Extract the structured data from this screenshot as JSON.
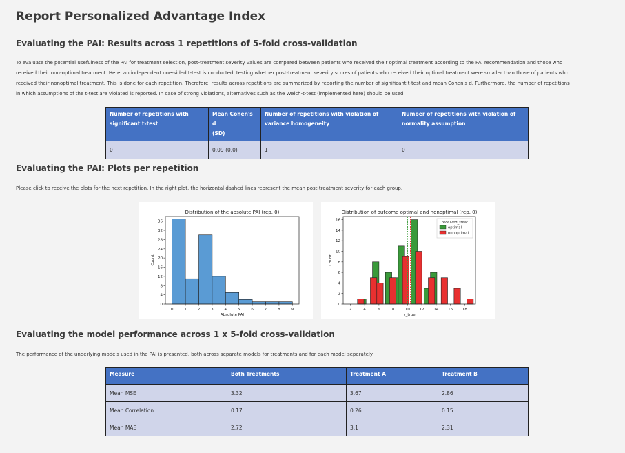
{
  "page_title": "Report Personalized Advantage Index",
  "section1": {
    "heading": "Evaluating the PAI: Results across 1 repetitions of 5-fold cross-validation",
    "paragraph_lines": [
      "To evaluate the potential usefulness of the PAI for treatment selection, post-treatment severity values are compared between patients who received their optimal treatment according to the PAI recommendation and those who",
      "received their non-optimal treatment. Here, an independent one-sided t-test is conducted, testing whether post-treatment severity scores of patients who received their optimal treatment were smaller than those of patients who",
      "received their nonoptimal treatment. This is done for each repetition. Therefore, results across repetitions are summarized by reporting the number of significant t-test and mean Cohen's d. Furthermore, the number of repetitions",
      "in which assumptions of the t-test are violated is reported. In case of strong violations, alternatives such as the Welch-t-test (implemented here) should be used."
    ],
    "table": {
      "headers": [
        [
          "Number of repetitions with",
          "significant t-test"
        ],
        [
          "Mean Cohen's d",
          "(SD)"
        ],
        [
          "Number of repetitions with violation of",
          "variance homogeneity"
        ],
        [
          "Number of repetitions with violation of",
          "normality assumption"
        ]
      ],
      "row": [
        "0",
        "0.09 (0.0)",
        "1",
        "0"
      ]
    }
  },
  "section2": {
    "heading": "Evaluating the PAI: Plots per repetition",
    "paragraph": "Please click to receive the plots for the next repetition. In the right plot, the horizontal dashed lines represent the mean post-treatment severity for each group."
  },
  "chart_data": [
    {
      "type": "bar",
      "title": "Distribution of the absolute PAI (rep. 0)",
      "xlabel": "Absolute PAI",
      "ylabel": "Count",
      "xlim": [
        -0.5,
        9.5
      ],
      "ylim": [
        0,
        38
      ],
      "xticks": [
        "0",
        "1",
        "2",
        "3",
        "4",
        "5",
        "6",
        "7",
        "8",
        "9"
      ],
      "yticks": [
        "0",
        "4",
        "8",
        "12",
        "16",
        "20",
        "24",
        "28",
        "32",
        "36"
      ],
      "bins": [
        [
          0,
          1
        ],
        [
          1,
          2
        ],
        [
          2,
          3
        ],
        [
          3,
          4
        ],
        [
          4,
          5
        ],
        [
          5,
          6
        ],
        [
          6,
          7
        ],
        [
          7,
          8
        ],
        [
          8,
          9
        ]
      ],
      "values": [
        37,
        11,
        30,
        12,
        5,
        2,
        1,
        1,
        1
      ],
      "color": "#5a9bd4"
    },
    {
      "type": "bar",
      "title": "Distribution of outcome optimal and nonoptimal (rep. 0)",
      "xlabel": "y_true",
      "ylabel": "Count",
      "xlim": [
        1,
        19.5
      ],
      "ylim": [
        0,
        16.6
      ],
      "xticks": [
        "2",
        "4",
        "6",
        "8",
        "10",
        "12",
        "14",
        "16",
        "18"
      ],
      "yticks": [
        "0",
        "2",
        "4",
        "6",
        "8",
        "10",
        "12",
        "14",
        "16"
      ],
      "legend_title": "received_treat",
      "legend_position": "top-right",
      "series": [
        {
          "name": "optimal",
          "color": "#3a9a3a",
          "bins": [
            [
              3.3,
              4.2
            ],
            [
              5.1,
              6.0
            ],
            [
              6.9,
              7.8
            ],
            [
              7.8,
              8.7
            ],
            [
              8.7,
              9.6
            ],
            [
              10.5,
              11.4
            ],
            [
              12.3,
              13.2
            ],
            [
              13.2,
              14.1
            ]
          ],
          "values": [
            1,
            8,
            6,
            5,
            11,
            16,
            3,
            6
          ]
        },
        {
          "name": "nonoptimal",
          "color": "#e83030",
          "bins": [
            [
              3.0,
              3.9
            ],
            [
              4.8,
              5.7
            ],
            [
              5.7,
              6.6
            ],
            [
              7.5,
              8.4
            ],
            [
              9.3,
              10.2
            ],
            [
              11.1,
              12.0
            ],
            [
              12.9,
              13.8
            ],
            [
              14.7,
              15.6
            ],
            [
              16.5,
              17.4
            ],
            [
              18.3,
              19.2
            ]
          ],
          "values": [
            1,
            5,
            4,
            5,
            9,
            10,
            5,
            5,
            3,
            1
          ]
        }
      ],
      "mean_lines": [
        {
          "group": "optimal",
          "x": 10.0,
          "color": "#3a9a3a"
        },
        {
          "group": "nonoptimal",
          "x": 10.4,
          "color": "#e83030"
        }
      ]
    }
  ],
  "section3": {
    "heading": "Evaluating the model performance across 1 x 5-fold cross-validation",
    "paragraph": "The performance of the underlying models used in the PAI is presented, both across separate models for treatments and for each model seperately",
    "table": {
      "headers": [
        "Measure",
        "Both Treatments",
        "Treatment A",
        "Treatment B"
      ],
      "rows": [
        [
          "Mean MSE",
          "3.32",
          "3.67",
          "2.86"
        ],
        [
          "Mean Correlation",
          "0.17",
          "0.26",
          "0.15"
        ],
        [
          "Mean MAE",
          "2.72",
          "3.1",
          "2.31"
        ]
      ]
    }
  }
}
